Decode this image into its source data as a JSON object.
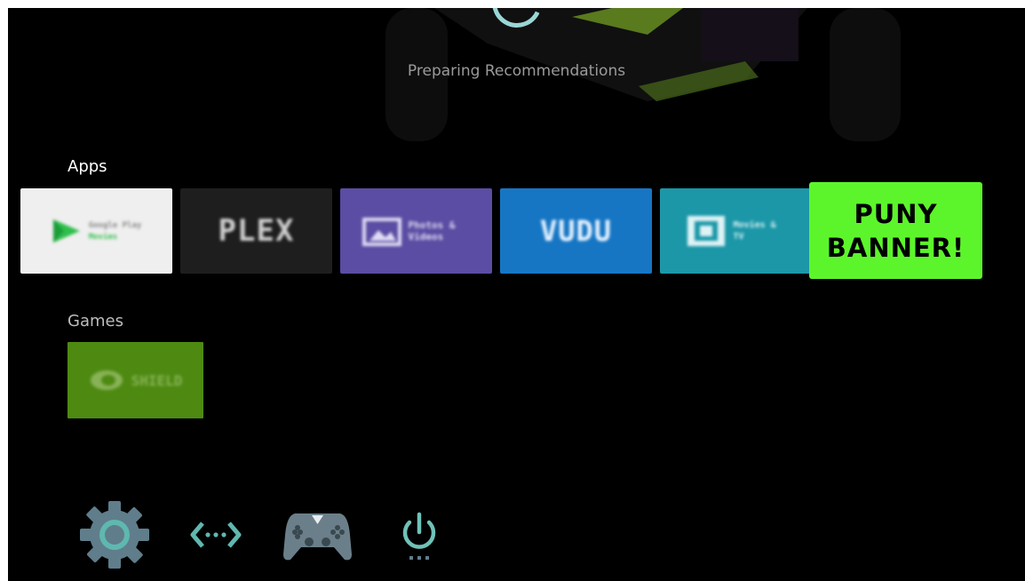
{
  "status": {
    "text": "Preparing Recommendations"
  },
  "rows": {
    "apps": {
      "title": "Apps",
      "tiles": [
        {
          "name": "Google Play",
          "sub": "Movies",
          "bg": "#efefef"
        },
        {
          "name": "PLEX",
          "bg": "#1e1e1e",
          "accent": "#e5a00d"
        },
        {
          "name": "Photos & Videos",
          "bg": "#5a4da3"
        },
        {
          "name": "VUDU",
          "bg": "#1676c4"
        },
        {
          "name": "Movies & TV",
          "bg": "#1b97a8"
        }
      ],
      "banner": {
        "line1": "PUNY",
        "line2": "BANNER!",
        "bg": "#5cf52b"
      }
    },
    "games": {
      "title": "Games",
      "tiles": [
        {
          "name": "SHIELD",
          "bg": "#4e8a12"
        }
      ]
    }
  },
  "dock": {
    "items": [
      {
        "icon": "settings-gear-icon",
        "color": "#607d8b"
      },
      {
        "icon": "network-connect-icon",
        "color": "#5fb8b0"
      },
      {
        "icon": "gamepad-icon",
        "color": "#6b7f8a"
      },
      {
        "icon": "power-icon",
        "color": "#6fc2b8"
      }
    ]
  }
}
